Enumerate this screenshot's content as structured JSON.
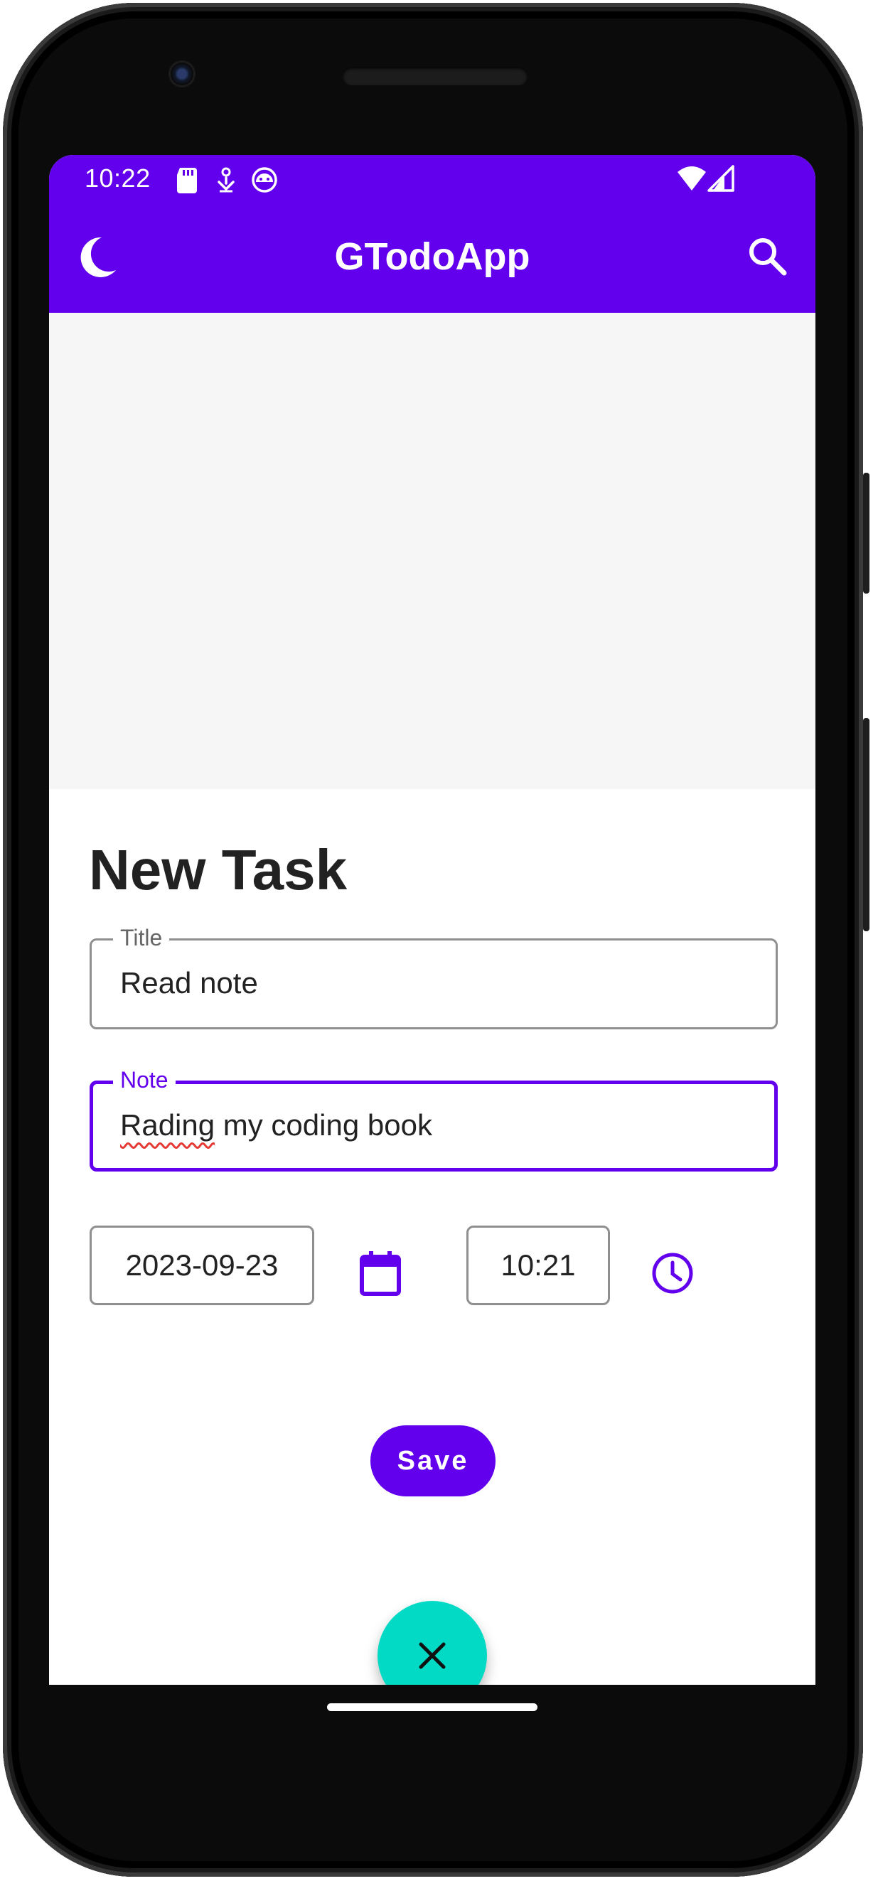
{
  "status_bar": {
    "time": "10:22",
    "icons": [
      "sd-card-icon",
      "notification-icon",
      "android-icon",
      "wifi-icon",
      "signal-icon"
    ]
  },
  "app_bar": {
    "title": "GTodoApp",
    "icons": [
      "moon-icon",
      "search-icon"
    ]
  },
  "form": {
    "heading": "New Task",
    "title_field": {
      "label": "Title",
      "value": "Read note"
    },
    "note_field": {
      "label": "Note",
      "value_misspelled": "Rading",
      "value_rest": " my coding book"
    },
    "date_value": "2023-09-23",
    "time_value": "10:21",
    "save_label": "Save"
  },
  "colors": {
    "primary": "#6200ee",
    "accent": "#03dac5",
    "spell_underline": "#e53935"
  }
}
